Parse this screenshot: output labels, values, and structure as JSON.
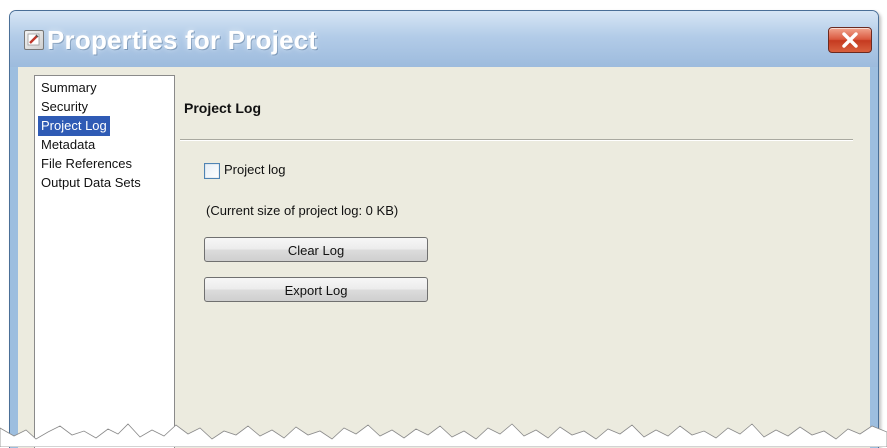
{
  "window": {
    "title": "Properties for Project",
    "close_icon": "close-icon"
  },
  "nav": {
    "items": [
      {
        "label": "Summary",
        "selected": false
      },
      {
        "label": "Security",
        "selected": false
      },
      {
        "label": "Project Log",
        "selected": true
      },
      {
        "label": "Metadata",
        "selected": false
      },
      {
        "label": "File References",
        "selected": false
      },
      {
        "label": "Output Data Sets",
        "selected": false
      }
    ]
  },
  "panel": {
    "title": "Project Log",
    "checkbox": {
      "label": "Project log",
      "checked": false
    },
    "size_text": "(Current size of project log: 0 KB)",
    "clear_button": "Clear Log",
    "export_button": "Export Log"
  },
  "colors": {
    "selection": "#2f5bb5",
    "client_background": "#ecebdf",
    "title_text": "#ffffff",
    "close_button": "#c53a20"
  }
}
